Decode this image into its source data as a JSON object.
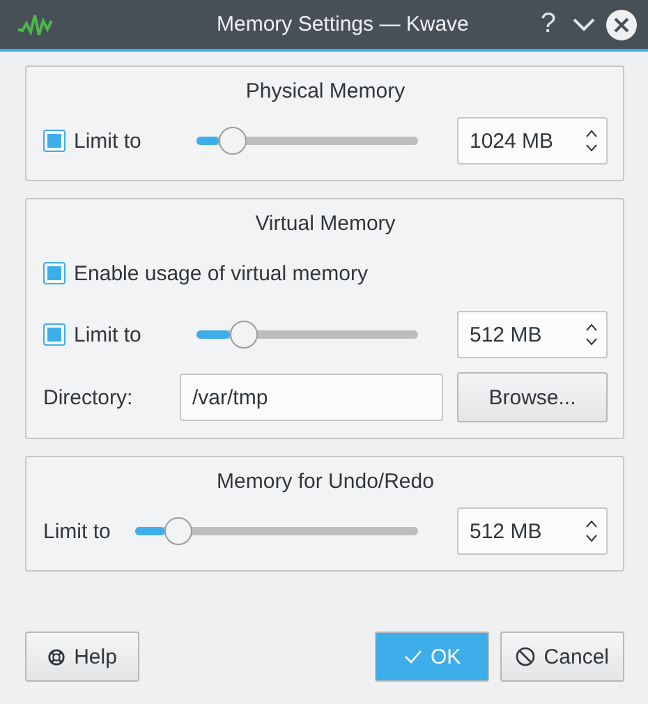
{
  "window": {
    "title": "Memory Settings — Kwave",
    "buttons": [
      "?"
    ]
  },
  "groups": [
    {
      "title": "Physical Memory",
      "rows": [
        {
          "kind": "limit",
          "checked": true,
          "label": "Limit to",
          "level": 0.1,
          "value": "1024 MB"
        }
      ]
    },
    {
      "title": "Virtual Memory",
      "rows": [
        {
          "kind": "option",
          "checked": true,
          "label": "Enable usage of virtual memory"
        },
        {
          "kind": "limit",
          "checked": true,
          "label": "Limit to",
          "level": 0.15,
          "value": "512 MB"
        },
        {
          "kind": "directory",
          "label": "Directory:",
          "value": "/var/tmp",
          "button": "Browse..."
        }
      ]
    },
    {
      "title": "Memory for Undo/Redo",
      "rows": [
        {
          "kind": "limit",
          "label": "Limit to",
          "level": 0.1,
          "value": "512 MB"
        }
      ]
    }
  ],
  "footer": {
    "help": "Help",
    "ok": "OK",
    "cancel": "Cancel"
  }
}
